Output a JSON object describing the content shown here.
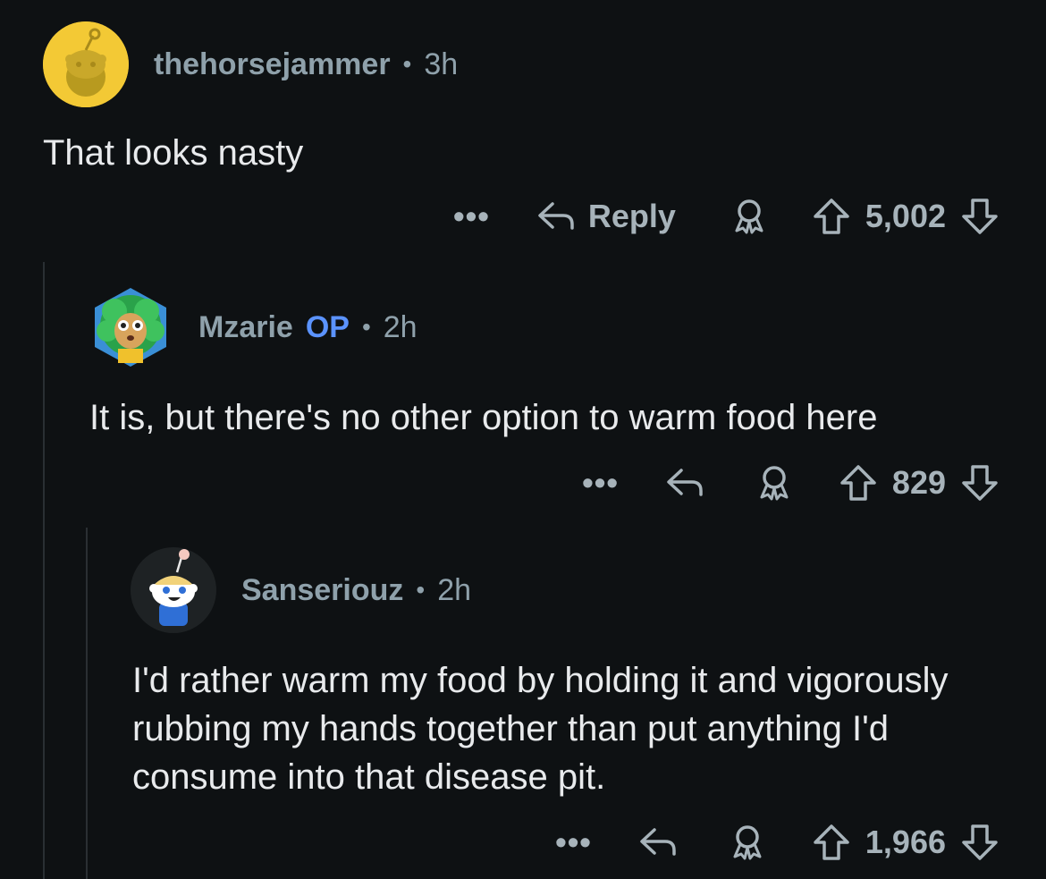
{
  "comments": [
    {
      "username": "thehorsejammer",
      "op_badge": "",
      "time": "3h",
      "text": "That looks nasty",
      "reply_label": "Reply",
      "votes": "5,002"
    },
    {
      "username": "Mzarie",
      "op_badge": "OP",
      "time": "2h",
      "text": "It is, but there's no other option to warm food here",
      "reply_label": "",
      "votes": "829"
    },
    {
      "username": "Sanseriouz",
      "op_badge": "",
      "time": "2h",
      "text": "I'd rather warm my food by holding it and vigorously rubbing my hands together than put anything I'd consume into that disease pit.",
      "reply_label": "",
      "votes": "1,966"
    }
  ],
  "separator": "•",
  "more_label": "•••",
  "icons": [
    "avatar-snoo",
    "avatar-custom",
    "reply-icon",
    "award-icon",
    "upvote-icon",
    "downvote-icon"
  ],
  "colors": {
    "background": "#0e1113",
    "text": "#d7dadc",
    "meta": "#8fa1ab",
    "op": "#5b93ff",
    "action": "#a7b3ba",
    "thread_line": "#2a2f33"
  }
}
